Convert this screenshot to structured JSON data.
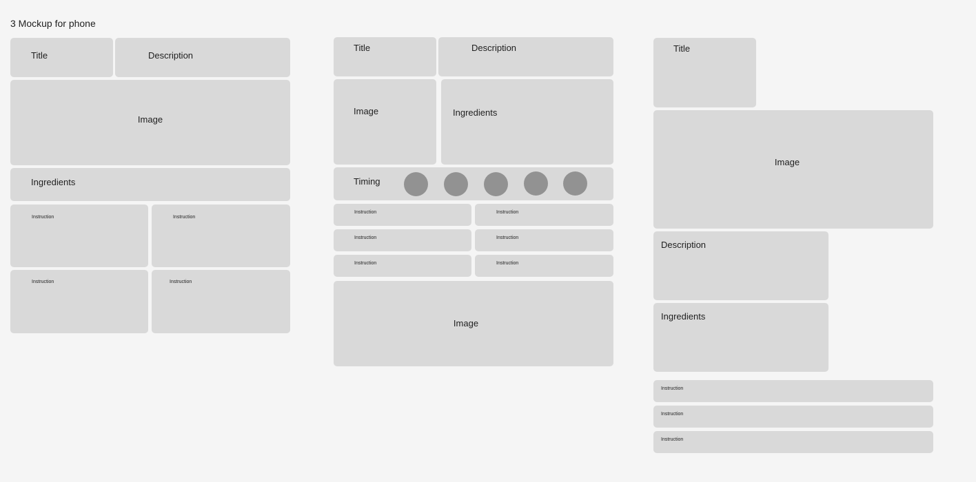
{
  "page_title": "3 Mockup for phone",
  "mockup_1": {
    "title": "Title",
    "description": "Description",
    "image": "Image",
    "ingredients": "Ingredients",
    "instructions": [
      "Instruction",
      "Instruction",
      "Instruction",
      "Instruction"
    ]
  },
  "mockup_2": {
    "title": "Title",
    "description": "Description",
    "image": "Image",
    "ingredients": "Ingredients",
    "timing": "Timing",
    "timing_steps": 5,
    "instructions": [
      "Instruction",
      "Instruction",
      "Instruction",
      "Instruction",
      "Instruction",
      "Instruction"
    ],
    "bottom_image": "Image"
  },
  "mockup_3": {
    "title": "Title",
    "image": "Image",
    "description": "Description",
    "ingredients": "Ingredients",
    "instructions": [
      "Instruction",
      "Instruction",
      "Instruction"
    ]
  },
  "colors": {
    "background": "#f5f5f5",
    "placeholder": "#d9d9d9",
    "timing_dot": "#929292",
    "text": "#1e1e1e"
  }
}
